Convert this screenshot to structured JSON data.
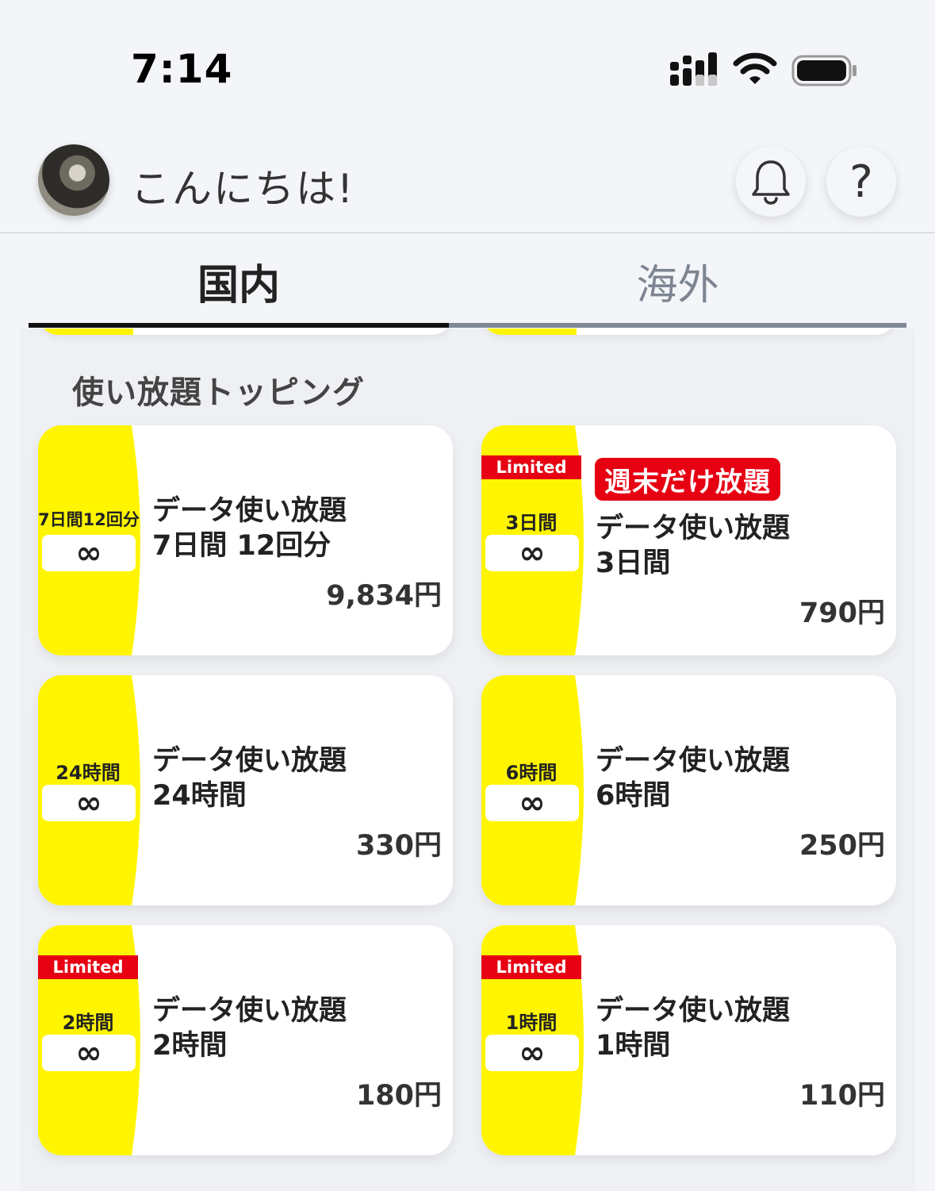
{
  "status_bar": {
    "time": "7:14"
  },
  "header": {
    "greeting": "こんにちは!",
    "help_label": "?"
  },
  "tabs": [
    {
      "label": "国内"
    },
    {
      "label": "海外"
    }
  ],
  "section": {
    "title": "使い放題トッピング"
  },
  "plans": [
    {
      "duration": "7日間12回分",
      "infinity": "∞",
      "title": "データ使い放題",
      "subtitle": "7日間 12回分",
      "price": "9,834円"
    },
    {
      "ribbon": "Limited",
      "badge": "週末だけ放題",
      "duration": "3日間",
      "infinity": "∞",
      "title": "データ使い放題",
      "subtitle": "3日間",
      "price": "790円"
    },
    {
      "duration": "24時間",
      "infinity": "∞",
      "title": "データ使い放題",
      "subtitle": "24時間",
      "price": "330円"
    },
    {
      "duration": "6時間",
      "infinity": "∞",
      "title": "データ使い放題",
      "subtitle": "6時間",
      "price": "250円"
    },
    {
      "ribbon": "Limited",
      "duration": "2時間",
      "infinity": "∞",
      "title": "データ使い放題",
      "subtitle": "2時間",
      "price": "180円"
    },
    {
      "ribbon": "Limited",
      "duration": "1時間",
      "infinity": "∞",
      "title": "データ使い放題",
      "subtitle": "1時間",
      "price": "110円"
    }
  ],
  "colors": {
    "band": "#fff500",
    "limited": "#e60012",
    "active_tab": "#111111"
  }
}
